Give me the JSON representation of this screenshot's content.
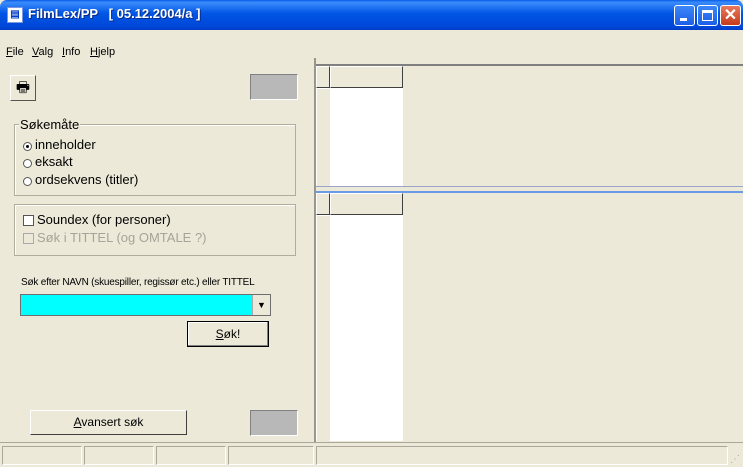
{
  "window": {
    "title": "FilmLex/PP   [ 05.12.2004/a ]",
    "icon": "film-icon",
    "title_bar_color": "#0055e5"
  },
  "menu": [
    {
      "label": "File",
      "underline": "F",
      "rest": "ile"
    },
    {
      "label": "Valg",
      "underline": "V",
      "rest": "alg"
    },
    {
      "label": "Info",
      "underline": "I",
      "rest": "nfo"
    },
    {
      "label": "Hjelp",
      "underline": "H",
      "rest": "jelp"
    }
  ],
  "toolbar": {
    "print_icon": "printer-icon"
  },
  "search_mode": {
    "legend": "Søkemåte",
    "options": [
      "inneholder",
      "eksakt",
      "ordsekvens (titler)"
    ],
    "selected": "inneholder"
  },
  "options": {
    "soundex_label": "Soundex (for personer)",
    "search_title_label": "Søk i TITTEL (og OMTALE ?)"
  },
  "search": {
    "label": "Søk efter NAVN (skuespiller, regissør etc.) eller TITTEL",
    "value": "",
    "field_color": "#00ffff",
    "button_label": "Søk!",
    "button_underline": "S",
    "button_rest": "øk!"
  },
  "advanced_button": {
    "label": "Avansert søk",
    "underline": "A",
    "rest": "vansert søk"
  }
}
